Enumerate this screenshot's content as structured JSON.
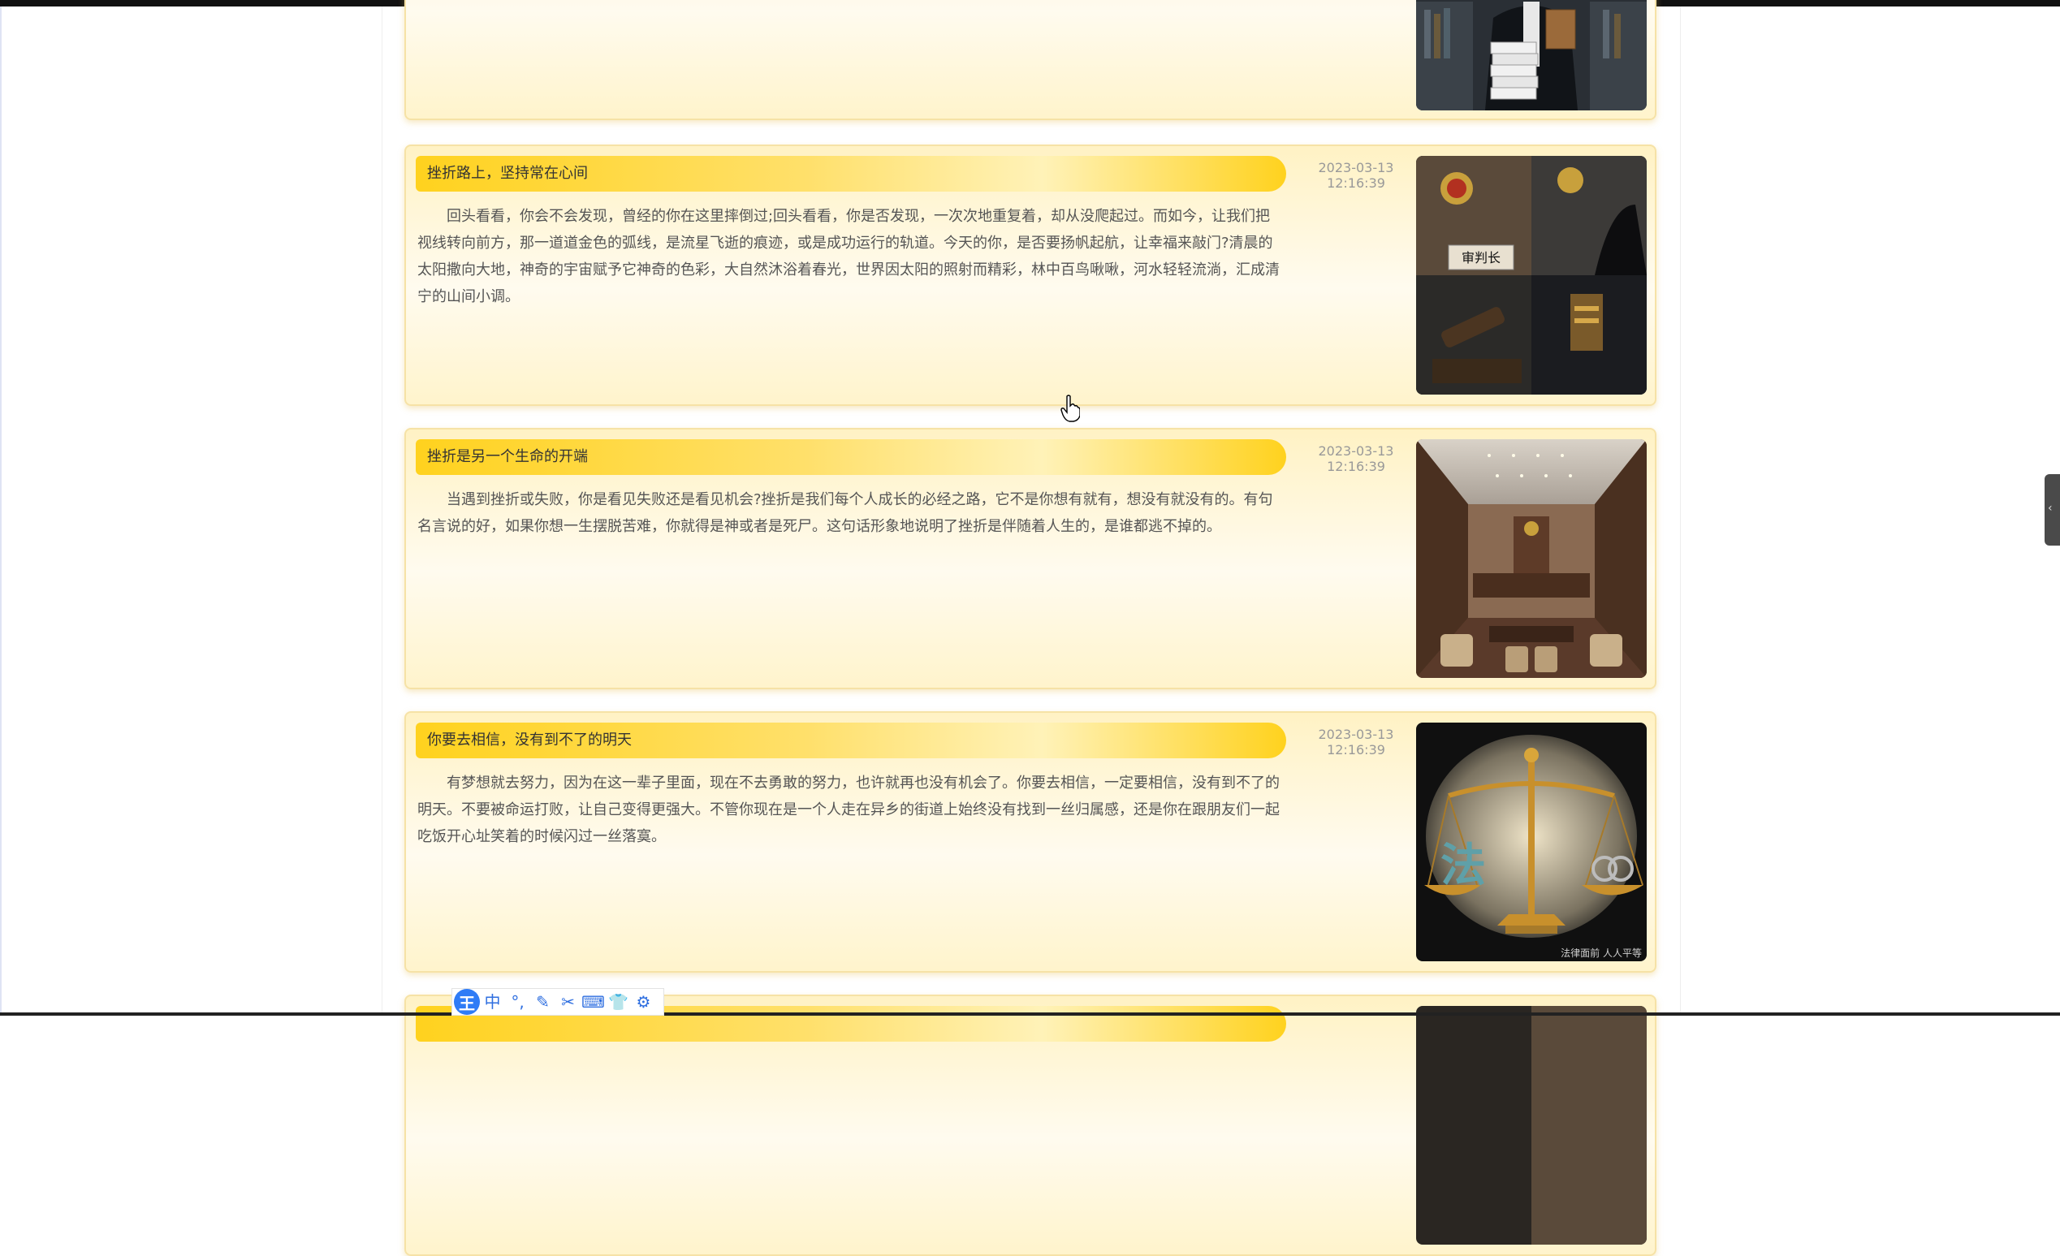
{
  "cards": [
    {
      "title": "",
      "body": "",
      "date": "",
      "time": ""
    },
    {
      "title": "挫折路上，坚持常在心间",
      "body": "回头看看，你会不会发现，曾经的你在这里摔倒过;回头看看，你是否发现，一次次地重复着，却从没爬起过。而如今，让我们把视线转向前方，那一道道金色的弧线，是流星飞逝的痕迹，或是成功运行的轨道。今天的你，是否要扬帆起航，让幸福来敲门?清晨的太阳撒向大地，神奇的宇宙赋予它神奇的色彩，大自然沐浴着春光，世界因太阳的照射而精彩，林中百鸟啾啾，河水轻轻流淌，汇成清宁的山间小调。",
      "date": "2023-03-13",
      "time": "12:16:39"
    },
    {
      "title": "挫折是另一个生命的开端",
      "body": "当遇到挫折或失败，你是看见失败还是看见机会?挫折是我们每个人成长的必经之路，它不是你想有就有，想没有就没有的。有句名言说的好，如果你想一生摆脱苦难，你就得是神或者是死尸。这句话形象地说明了挫折是伴随着人生的，是谁都逃不掉的。",
      "date": "2023-03-13",
      "time": "12:16:39"
    },
    {
      "title": "你要去相信，没有到不了的明天",
      "body": "有梦想就去努力，因为在这一辈子里面，现在不去勇敢的努力，也许就再也没有机会了。你要去相信，一定要相信，没有到不了的明天。不要被命运打败，让自己变得更强大。不管你现在是一个人走在异乡的街道上始终没有找到一丝归属感，还是你在跟朋友们一起吃饭开心址笑着的时候闪过一丝落寞。",
      "date": "2023-03-13",
      "time": "12:16:39"
    },
    {
      "title": "",
      "body": "",
      "date": "",
      "time": ""
    }
  ],
  "image_text": {
    "judge_plate": "审判长",
    "law_glyph": "法",
    "watermark": "法律面前 人人平等"
  },
  "ime_toolbar": {
    "logo": "王",
    "items": [
      "中",
      "°,",
      "✎",
      "✂",
      "⌨",
      "👕",
      "⚙"
    ]
  },
  "colors": {
    "title_bar": "#ffd21e",
    "card_border": "#f6e2a6",
    "card_bg": "#fff8de",
    "date_text": "#999999",
    "ime_blue": "#2f7cf6"
  }
}
